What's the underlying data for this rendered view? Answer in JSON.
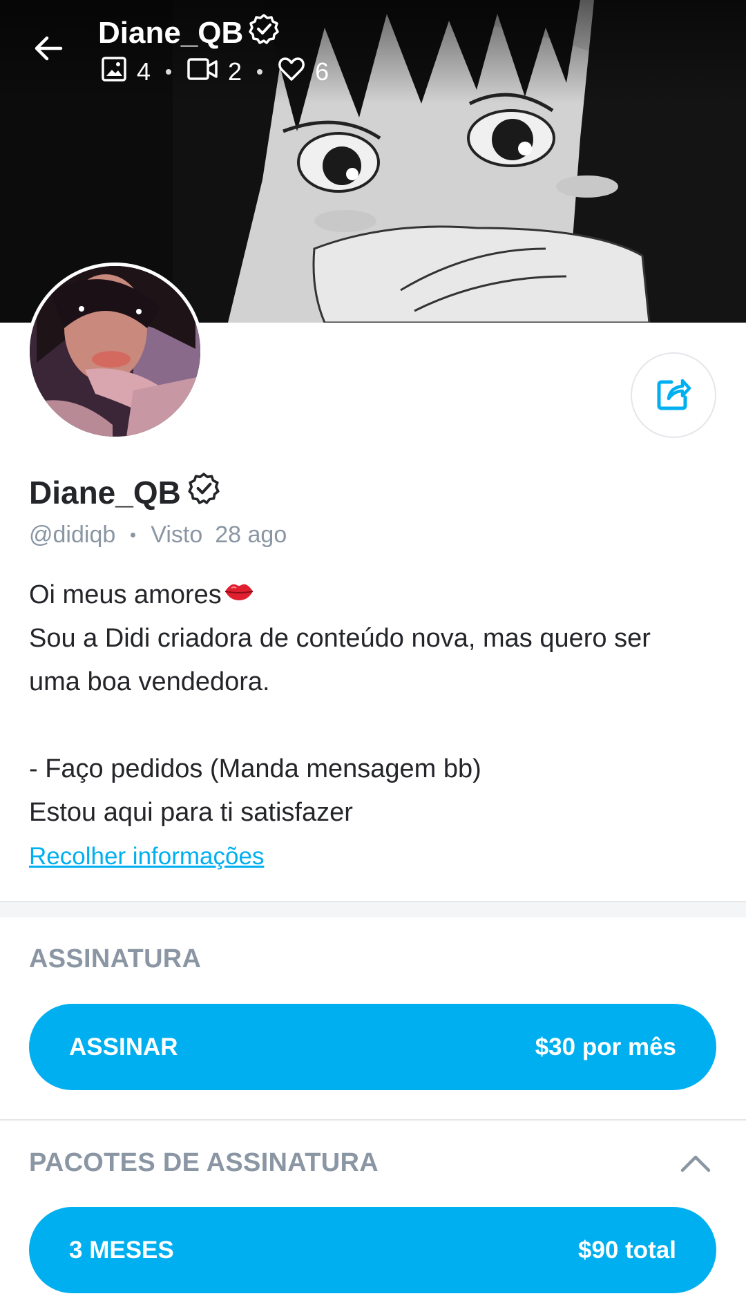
{
  "header": {
    "title": "Diane_QB",
    "stats": {
      "photos": "4",
      "videos": "2",
      "likes": "6"
    }
  },
  "profile": {
    "name": "Diane_QB",
    "handle": "@didiqb",
    "seen_label": "Visto",
    "seen_value": "28 ago",
    "bio": {
      "line1": "Oi meus amores",
      "line2": "Sou a Didi criadora de conteúdo nova, mas quero ser",
      "line3": "uma boa vendedora.",
      "line4": "- Faço pedidos (Manda mensagem bb)",
      "line5": "Estou aqui para ti satisfazer"
    },
    "collapse_link": "Recolher informações"
  },
  "subscription": {
    "title": "ASSINATURA",
    "button_label": "ASSINAR",
    "button_price": "$30 por mês"
  },
  "bundles": {
    "title": "PACOTES DE ASSINATURA",
    "items": [
      {
        "label": "3 MESES",
        "price": "$90 total"
      }
    ]
  },
  "colors": {
    "accent": "#00aff0",
    "muted": "#8a96a3",
    "text": "#242529"
  },
  "icons": [
    "back-arrow-icon",
    "verified-icon",
    "image-icon",
    "video-icon",
    "heart-icon",
    "share-icon",
    "lips-icon",
    "chevron-up-icon"
  ]
}
